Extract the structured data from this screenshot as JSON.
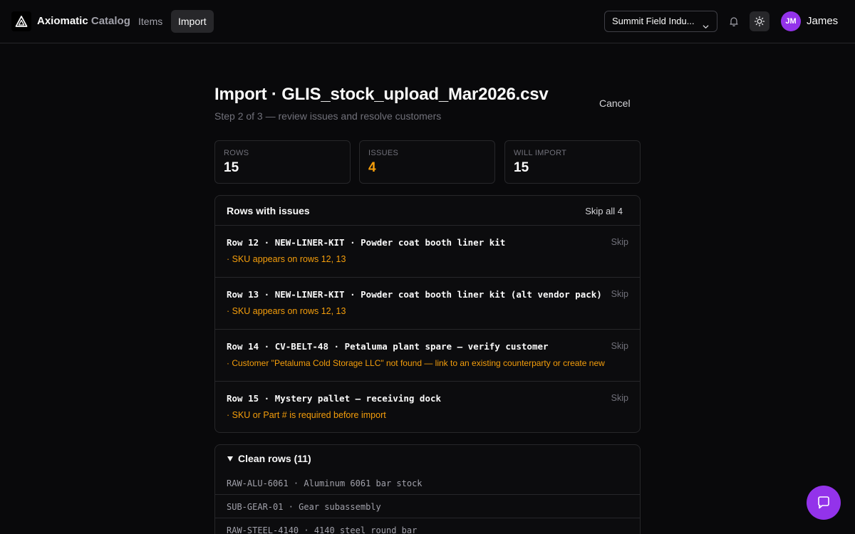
{
  "header": {
    "brand_primary": "Axiomatic",
    "brand_secondary": "Catalog",
    "nav": [
      {
        "label": "Items",
        "active": false
      },
      {
        "label": "Import",
        "active": true
      }
    ],
    "org_selector": "Summit Field Indu...",
    "user": {
      "initials": "JM",
      "name": "James"
    },
    "icons": [
      "axiomatic-logo-icon",
      "chevron-down-icon",
      "bell-icon",
      "sun-icon",
      "chat-icon"
    ]
  },
  "page": {
    "title": "Import · GLIS_stock_upload_Mar2026.csv",
    "subtitle": "Step 2 of 3 — review issues and resolve customers",
    "cancel_label": "Cancel"
  },
  "stats": [
    {
      "label": "ROWS",
      "value": "15"
    },
    {
      "label": "ISSUES",
      "value": "4"
    },
    {
      "label": "WILL IMPORT",
      "value": "15"
    }
  ],
  "issues": {
    "title": "Rows with issues",
    "skip_all_label": "Skip all 4",
    "rows": [
      {
        "line": "Row 12 · NEW-LINER-KIT · Powder coat booth liner kit",
        "message": "· SKU appears on rows 12, 13",
        "skip_label": "Skip"
      },
      {
        "line": "Row 13 · NEW-LINER-KIT · Powder coat booth liner kit (alt vendor pack)",
        "message": "· SKU appears on rows 12, 13",
        "skip_label": "Skip"
      },
      {
        "line": "Row 14 · CV-BELT-48 · Petaluma plant spare — verify customer",
        "message": "· Customer \"Petaluma Cold Storage LLC\" not found — link to an existing counterparty or create new",
        "skip_label": "Skip"
      },
      {
        "line": "Row 15 · Mystery pallet — receiving dock",
        "message": "· SKU or Part # is required before import",
        "skip_label": "Skip"
      }
    ]
  },
  "clean": {
    "title": "Clean rows (11)",
    "rows": [
      "RAW-ALU-6061 · Aluminum 6061 bar stock",
      "SUB-GEAR-01 · Gear subassembly",
      "RAW-STEEL-4140 · 4140 steel round bar"
    ]
  },
  "colors": {
    "background": "#09090b",
    "border": "#27272a",
    "warning": "#f59e0b",
    "accent": "#9333ea"
  }
}
